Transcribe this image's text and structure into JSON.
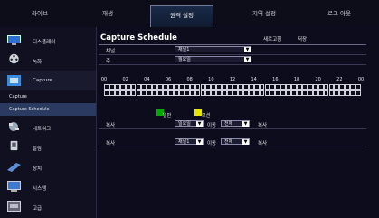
{
  "tabs": {
    "live": "라이브",
    "search": "재생",
    "remote": "원격 설정",
    "local": "지역 설정",
    "logout": "로그 아웃"
  },
  "sidebar": {
    "items": [
      {
        "label": "디스플레이",
        "icon": "monitor-icon"
      },
      {
        "label": "녹화",
        "icon": "film-reel-icon"
      },
      {
        "label": "Capture",
        "icon": "capture-icon"
      },
      {
        "label": "네트워크",
        "icon": "network-icon"
      },
      {
        "label": "알람",
        "icon": "alarm-icon"
      },
      {
        "label": "장치",
        "icon": "device-icon"
      },
      {
        "label": "시스템",
        "icon": "system-icon"
      },
      {
        "label": "고급",
        "icon": "advanced-icon"
      }
    ],
    "sub_items": [
      "Capture",
      "Capture Schedule"
    ]
  },
  "main": {
    "title": "Capture Schedule",
    "refresh": "새로고침",
    "save": "저장",
    "channel_label": "채널",
    "channel_value": "채널1",
    "week_label": "주",
    "week_value": "월요일",
    "hours": [
      "00",
      "02",
      "04",
      "06",
      "08",
      "10",
      "12",
      "14",
      "16",
      "18",
      "20",
      "22",
      "00"
    ],
    "legend_normal": "일반",
    "legend_event": "모션",
    "copy1": {
      "label": "복사",
      "from": "일요일",
      "to_label": "이동",
      "to": "전체",
      "button": "복사"
    },
    "copy2": {
      "label": "복사",
      "from": "채널1",
      "to_label": "이동",
      "to": "전체",
      "button": "복사"
    }
  },
  "colors": {
    "normal": "#00aa00",
    "event": "#e6e600",
    "accent": "#1a2a48"
  }
}
